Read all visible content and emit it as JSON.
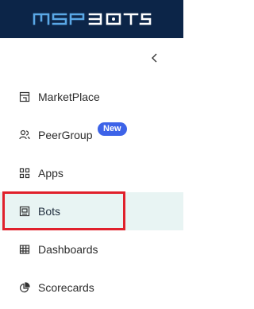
{
  "header": {
    "logo_text": "MSPBOTS",
    "colors": {
      "background": "#0c2548",
      "logo": "#5aa8e6"
    }
  },
  "collapse": {
    "icon": "chevron-left-icon"
  },
  "nav": {
    "items": [
      {
        "label": "MarketPlace",
        "icon": "store-icon"
      },
      {
        "label": "PeerGroup",
        "icon": "people-icon",
        "badge": "New"
      },
      {
        "label": "Apps",
        "icon": "apps-grid-icon"
      },
      {
        "label": "Bots",
        "icon": "bot-icon",
        "active": true
      },
      {
        "label": "Dashboards",
        "icon": "table-grid-icon"
      },
      {
        "label": "Scorecards",
        "icon": "pie-chart-icon"
      }
    ],
    "colors": {
      "active_bg": "#e8f4f3",
      "badge_bg": "#3d63e8",
      "highlight": "#e0202b"
    }
  }
}
